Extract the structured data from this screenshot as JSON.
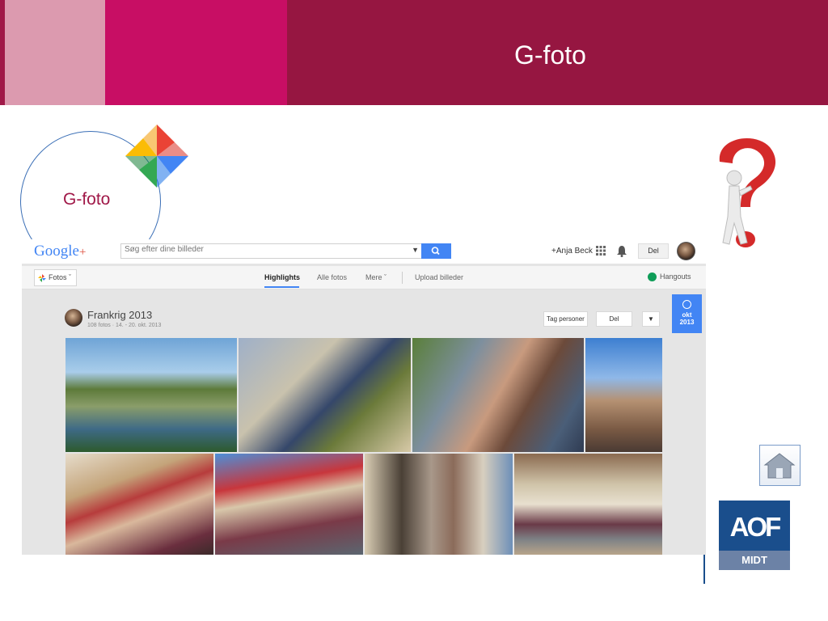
{
  "slide": {
    "title": "G-foto",
    "circle_label": "G-foto"
  },
  "gplus": {
    "logo": "Google",
    "logo_plus": "+",
    "search_placeholder": "Søg efter dine billeder",
    "user": "+Anja Beck",
    "share": "Del"
  },
  "subnav": {
    "fotos": "Fotos",
    "tabs": [
      {
        "label": "Highlights",
        "active": true
      },
      {
        "label": "Alle fotos",
        "active": false
      },
      {
        "label": "Mere",
        "active": false
      },
      {
        "label": "Upload billeder",
        "active": false
      }
    ],
    "hangouts": "Hangouts"
  },
  "album": {
    "title": "Frankrig 2013",
    "meta": "108 fotos · 14. - 20. okt. 2013",
    "tag_people": "Tag personer",
    "share": "Del",
    "date_month": "okt",
    "date_year": "2013"
  },
  "logos": {
    "aof": "AOF",
    "aof_sub": "MIDT"
  },
  "colors": {
    "banner_dark": "#961641",
    "banner_magenta": "#c80e64",
    "banner_pink": "#dc9aaf",
    "accent_blue": "#4285f4",
    "aof_blue": "#1a4e8c"
  }
}
